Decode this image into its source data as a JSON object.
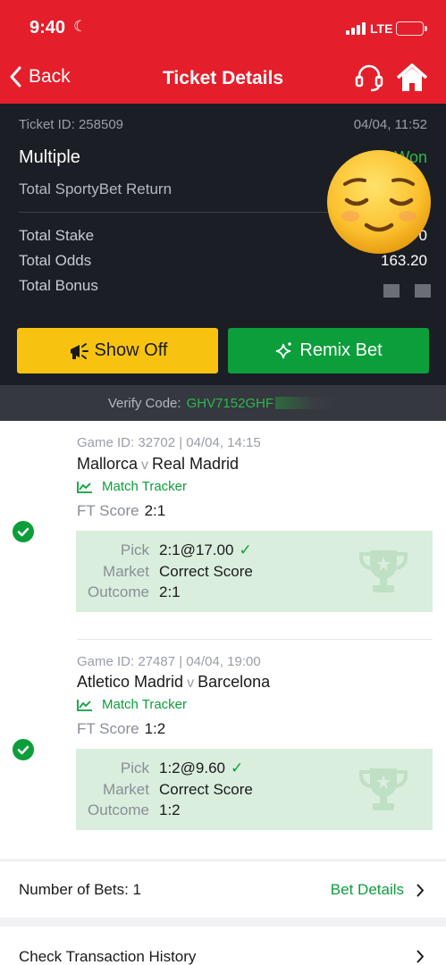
{
  "status_bar": {
    "time": "9:40",
    "network": "LTE"
  },
  "nav": {
    "back_label": "Back",
    "title": "Ticket Details"
  },
  "summary": {
    "ticket_id": "Ticket ID: 258509",
    "date": "04/04, 11:52",
    "bet_type": "Multiple",
    "status": "Won",
    "return_label": "Total SportyBet Return",
    "rows": [
      {
        "label": "Total Stake",
        "value": "0"
      },
      {
        "label": "Total Odds",
        "value": "163.20"
      },
      {
        "label": "Total Bonus",
        "value": ""
      }
    ]
  },
  "buttons": {
    "show_off": "Show Off",
    "remix": "Remix Bet"
  },
  "verify": {
    "label": "Verify Code:",
    "code": "GHV7152GHF"
  },
  "games": [
    {
      "game_id": "Game ID: 32702 | 04/04, 14:15",
      "home": "Mallorca",
      "vs": "v",
      "away": "Real Madrid",
      "tracker": "Match Tracker",
      "ft_label": "FT Score",
      "ft_value": "2:1",
      "pick_label": "Pick",
      "pick_value": "2:1@17.00",
      "market_label": "Market",
      "market_value": "Correct Score",
      "outcome_label": "Outcome",
      "outcome_value": "2:1"
    },
    {
      "game_id": "Game ID: 27487 | 04/04, 19:00",
      "home": "Atletico Madrid",
      "vs": "v",
      "away": "Barcelona",
      "tracker": "Match Tracker",
      "ft_label": "FT Score",
      "ft_value": "1:2",
      "pick_label": "Pick",
      "pick_value": "1:2@9.60",
      "market_label": "Market",
      "market_value": "Correct Score",
      "outcome_label": "Outcome",
      "outcome_value": "1:2"
    }
  ],
  "footer": {
    "bet_count": "Number of Bets: 1",
    "bet_details": "Bet Details",
    "transaction_history": "Check Transaction History"
  },
  "colors": {
    "brand_red": "#e41e2b",
    "green": "#0c9e3b",
    "yellow": "#f8c310",
    "dark": "#1b1e25"
  }
}
